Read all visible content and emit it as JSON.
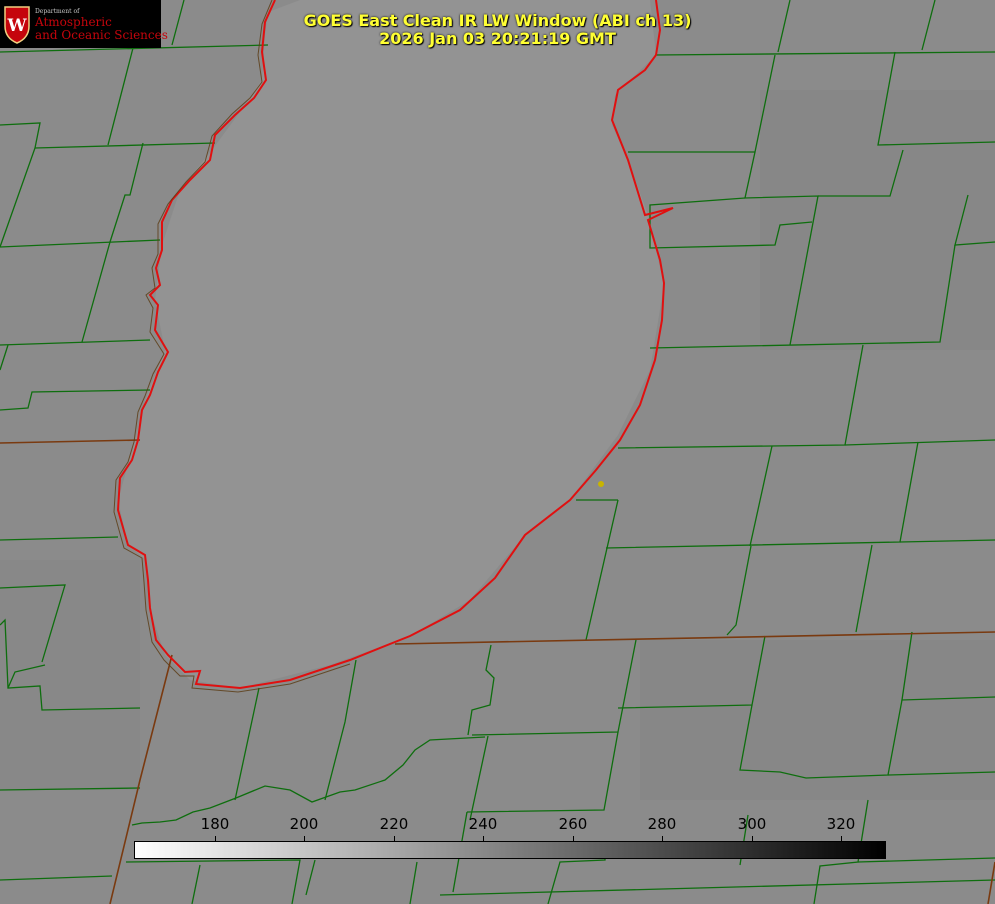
{
  "title": {
    "line1": "GOES East Clean IR LW Window (ABI ch 13)",
    "line2": "2026 Jan 03 20:21:19 GMT"
  },
  "logo": {
    "department": "Department of",
    "line1": "Atmospheric",
    "line2": "and Oceanic Sciences",
    "crest_letter": "W"
  },
  "colorbar": {
    "ticks": [
      "180",
      "200",
      "220",
      "240",
      "260",
      "280",
      "300",
      "320"
    ],
    "gradient_start": "#ffffff",
    "gradient_end": "#000000"
  },
  "colors": {
    "lake_outline": "#e01010",
    "county_lines": "#0e6e0e",
    "state_lines": "#7a3a10",
    "title_text": "#ffff33",
    "marker": "#c8b400",
    "logo_red": "#c5050c"
  }
}
